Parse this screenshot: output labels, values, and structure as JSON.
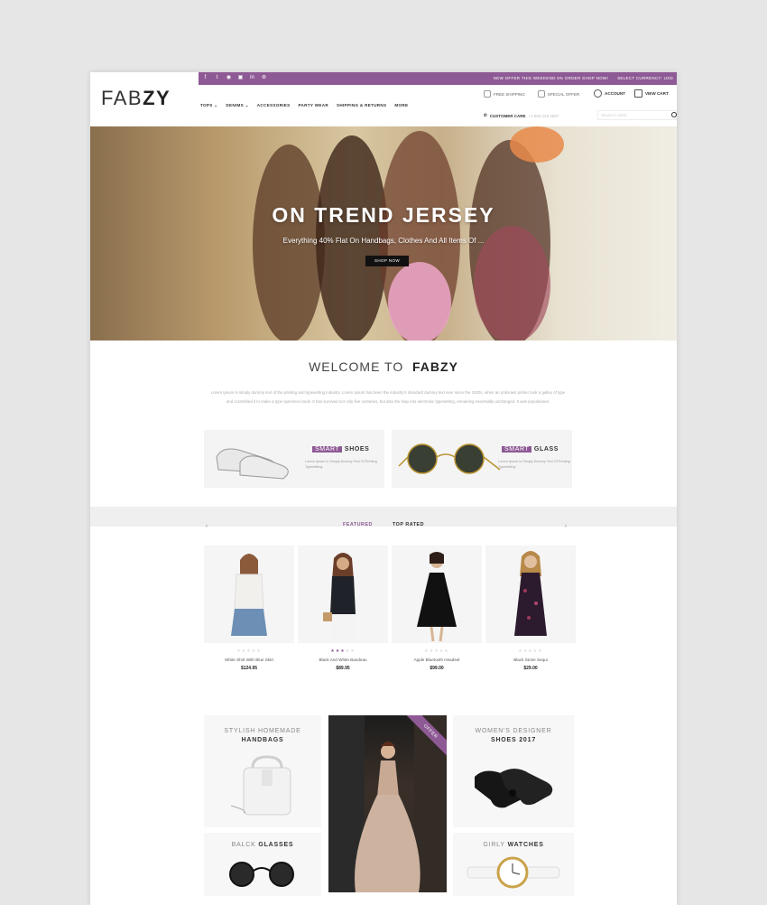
{
  "brand": {
    "logo_light": "FAB",
    "logo_bold": "ZY"
  },
  "topbar": {
    "social_icons": [
      "facebook-icon",
      "twitter-icon",
      "rss-icon",
      "instagram-icon",
      "linkedin-icon",
      "dribbble-icon"
    ],
    "promo": "NEW OFFER THIS WEEKEND 5%  ORDER SHOP NOW!",
    "currency": "SELECT CURRENCY: USD",
    "accent": "#8e5a95"
  },
  "nav": {
    "items": [
      "TOPS ⌄",
      "DENIMS ⌄",
      "ACCESSORIES",
      "PARTY WEAR",
      "SHIPPING & RETURNS",
      "MORE"
    ]
  },
  "header": {
    "free_shipping": "FREE SHIPPING",
    "special_offer": "SPECIAL OFFER",
    "account": "ACCOUNT",
    "cart": "VIEW CART",
    "customer_care": "CUSTOMER CARE",
    "phone": "+1 800 123 4567",
    "search_placeholder": "SEARCH HERE"
  },
  "hero": {
    "title": "ON TREND JERSEY",
    "subtitle": "Everything 40% Flat On Handbags, Clothes And All Items Of ...",
    "button": "SHOP NOW"
  },
  "welcome": {
    "title_light": "WELCOME TO",
    "title_bold": "FABZY",
    "text": "Lorem Ipsum is simply dummy text of the printing and typesetting industry. Lorem Ipsum has been the industry's standard dummy text ever since the 1500s, when an unknown printer took a galley of type and scrambled it to make a type specimen book. It has survived not only five centuries, but also the leap into electronic typesetting, remaining essentially unchanged. It was popularised."
  },
  "promos": [
    {
      "tag": "SMART",
      "title": "SHOES",
      "desc": "Lorem Ipsum Is Simply Dummy Text Of Printing Typesetting"
    },
    {
      "tag": "SMART",
      "title": "GLASS",
      "desc": "Lorem Ipsum Is Simply Dummy Text Of Printing Typesetting"
    }
  ],
  "tabs": {
    "featured": "FEATURED",
    "top_rated": "TOP RATED",
    "prev": "‹",
    "next": "›"
  },
  "products": [
    {
      "name": "White Shirt With Blue Skirt",
      "price": "$124.95",
      "rating": 0
    },
    {
      "name": "Black And White Bandeau",
      "price": "$89.95",
      "rating": 3
    },
    {
      "name": "Apple Bluetooth Headset",
      "price": "$99.00",
      "rating": 0
    },
    {
      "name": "Black Stone Sequi",
      "price": "$29.00",
      "rating": 0
    }
  ],
  "categories": {
    "handbags": {
      "line1": "STYLISH HOMEMADE",
      "line2": "HANDBAGS"
    },
    "shoes": {
      "line1": "WOMEN'S DESIGNER",
      "line2": "SHOES 2017"
    },
    "glasses": {
      "dim": "BALCK",
      "bold": "GLASSES"
    },
    "watches": {
      "dim": "GIRLY",
      "bold": "WATCHES"
    },
    "offer_ribbon": "OFFER"
  }
}
